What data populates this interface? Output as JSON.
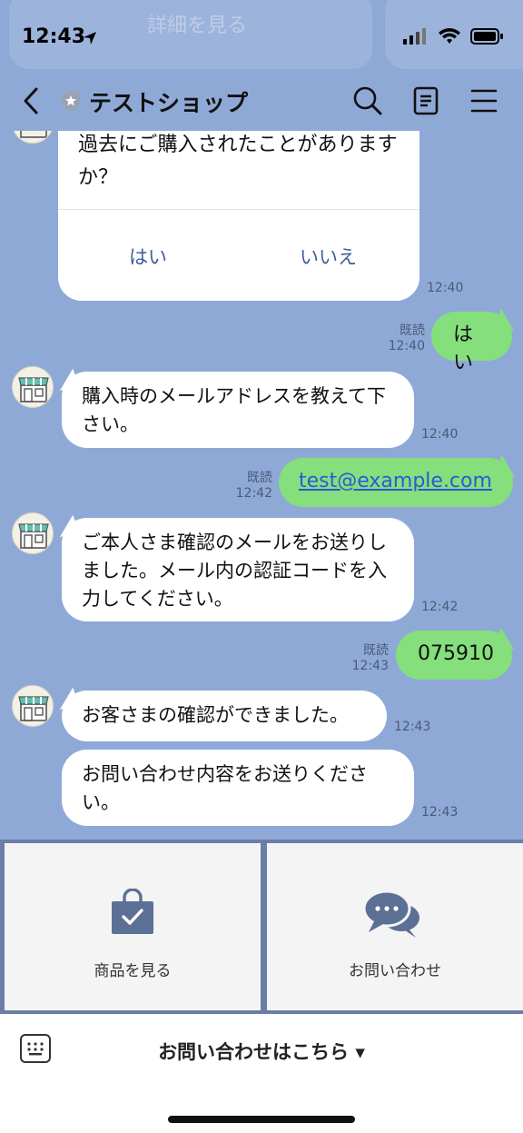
{
  "status_bar": {
    "time": "12:43",
    "prev_card_text": "詳細を見る"
  },
  "header": {
    "title": "テストショップ"
  },
  "quick_reply": {
    "question": "過去にご購入されたことがありますか？",
    "yes_label": "はい",
    "no_label": "いいえ",
    "time": "12:40"
  },
  "messages": [
    {
      "side": "right",
      "text": "はい",
      "read": "既読",
      "time": "12:40"
    },
    {
      "side": "left",
      "text": "購入時のメールアドレスを教えて下さい。",
      "time": "12:40"
    },
    {
      "side": "right",
      "text": "test@example.com",
      "read": "既読",
      "time": "12:42"
    },
    {
      "side": "left",
      "text": "ご本人さま確認のメールをお送りしました。メール内の認証コードを入力してください。",
      "time": "12:42"
    },
    {
      "side": "right",
      "text": "075910",
      "read": "既読",
      "time": "12:43"
    },
    {
      "side": "left",
      "text": "お客さまの確認ができました。",
      "time": "12:43"
    },
    {
      "side": "left",
      "text": "お問い合わせ内容をお送りください。",
      "time": "12:43"
    }
  ],
  "rich_menu": {
    "items": [
      {
        "label": "商品を見る",
        "icon": "shopping-bag-icon"
      },
      {
        "label": "お問い合わせ",
        "icon": "chat-bubbles-icon"
      }
    ]
  },
  "bottom_bar": {
    "label": "お問い合わせはこちら ▾"
  },
  "colors": {
    "chat_background": "#8fa9d7",
    "user_bubble": "#84df7c",
    "rich_menu_frame": "#6c7ea6",
    "quick_reply_text": "#3b5f99"
  }
}
